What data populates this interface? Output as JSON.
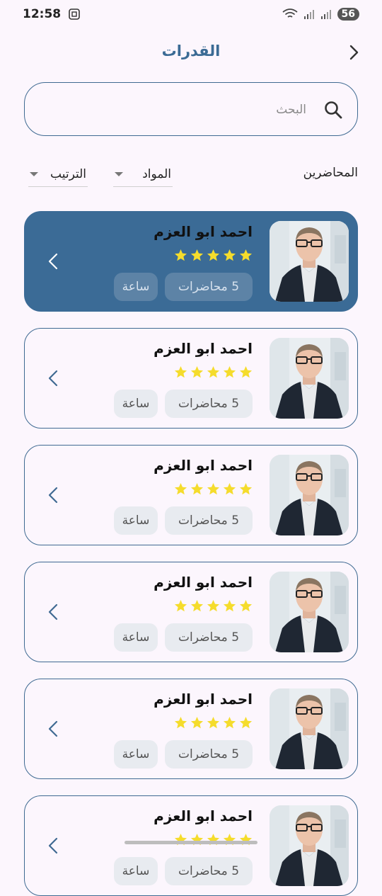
{
  "status_bar": {
    "time": "12:58",
    "battery": "56",
    "icons": [
      "screenshot-icon",
      "wifi-icon",
      "signal-icon",
      "signal-icon",
      "battery-icon"
    ]
  },
  "header": {
    "title": "القدرات",
    "back_icon": "chevron-right-icon"
  },
  "search": {
    "placeholder": "البحث",
    "icon": "search-icon"
  },
  "filters": {
    "label": "المحاضرين",
    "subjects": "المواد",
    "sort": "الترتيب"
  },
  "colors": {
    "accent": "#3b6b96",
    "star": "#f5dc2c",
    "background": "#fcf6fd"
  },
  "instructors": [
    {
      "name": "احمد ابو العزم",
      "rating": 5,
      "lectures": "5  محاضرات",
      "hours": "ساعة",
      "active": true
    },
    {
      "name": "احمد ابو العزم",
      "rating": 5,
      "lectures": "5  محاضرات",
      "hours": "ساعة",
      "active": false
    },
    {
      "name": "احمد ابو العزم",
      "rating": 5,
      "lectures": "5  محاضرات",
      "hours": "ساعة",
      "active": false
    },
    {
      "name": "احمد ابو العزم",
      "rating": 5,
      "lectures": "5  محاضرات",
      "hours": "ساعة",
      "active": false
    },
    {
      "name": "احمد ابو العزم",
      "rating": 5,
      "lectures": "5  محاضرات",
      "hours": "ساعة",
      "active": false
    },
    {
      "name": "احمد ابو العزم",
      "rating": 5,
      "lectures": "5  محاضرات",
      "hours": "ساعة",
      "active": false
    }
  ]
}
